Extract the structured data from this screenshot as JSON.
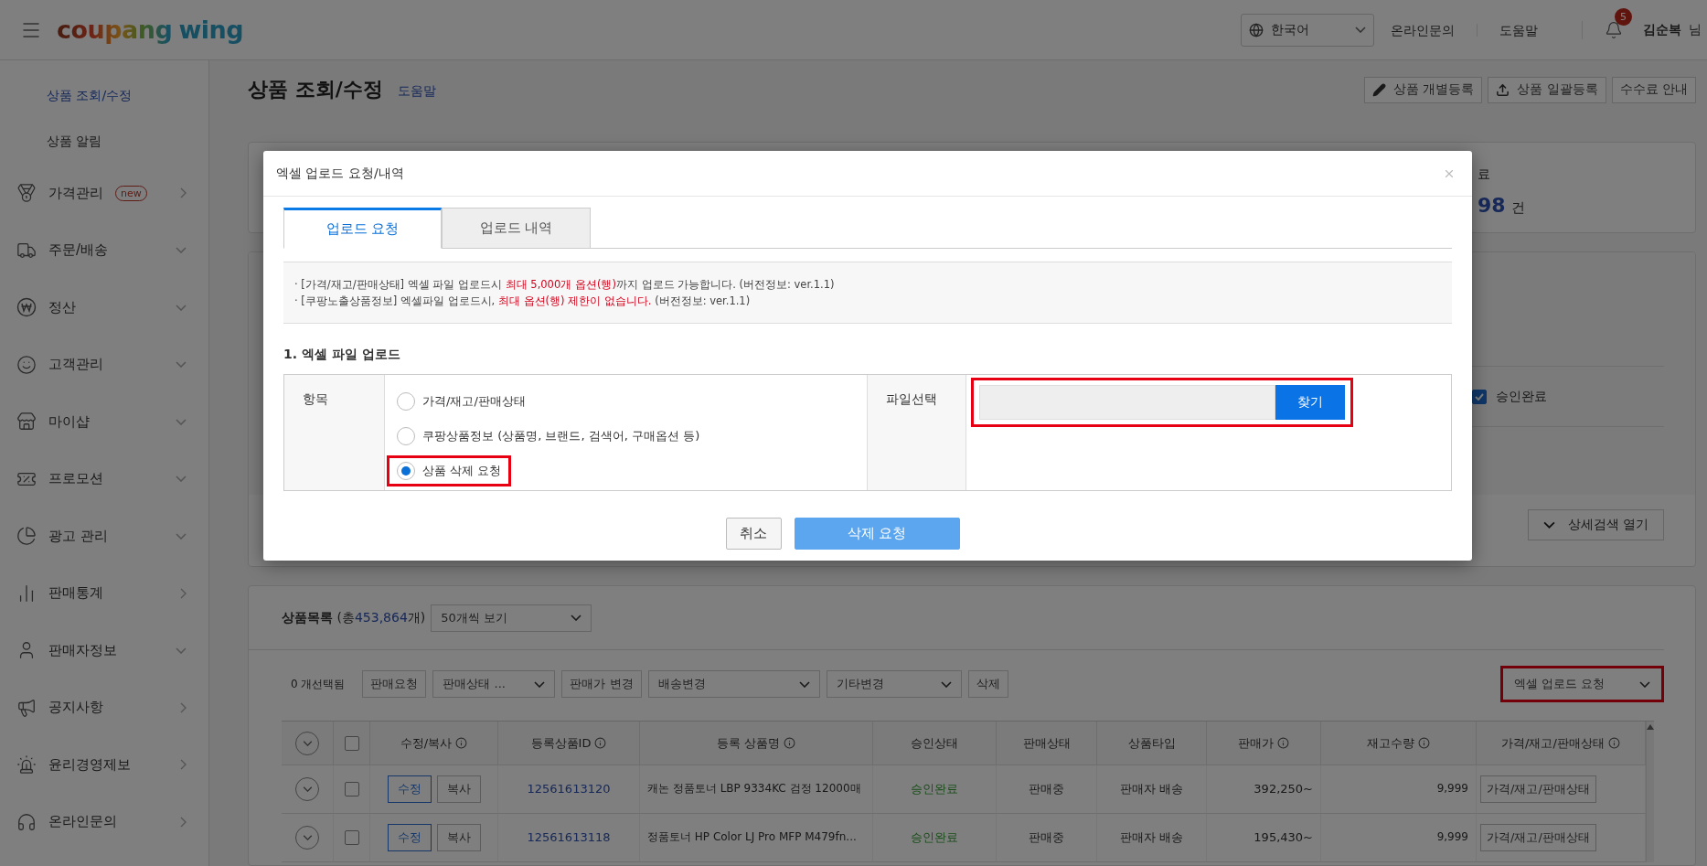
{
  "header": {
    "logo": {
      "brand": "coupang",
      "product": "wing"
    },
    "language": "한국어",
    "links": [
      "온라인문의",
      "도움말"
    ],
    "notifications": "5",
    "user": {
      "name": "김순복",
      "suffix": "님"
    }
  },
  "sidebar": {
    "subitems": [
      {
        "label": "상품 조회/수정",
        "selected": true
      },
      {
        "label": "상품 알림",
        "selected": false
      }
    ],
    "items": [
      {
        "kind": "medal",
        "label": "가격관리",
        "badge": "new",
        "expandable": false
      },
      {
        "kind": "truck",
        "label": "주문/배송",
        "expandable": true
      },
      {
        "kind": "won",
        "label": "정산",
        "expandable": true
      },
      {
        "kind": "smile",
        "label": "고객관리",
        "expandable": true
      },
      {
        "kind": "store",
        "label": "마이샵",
        "expandable": true
      },
      {
        "kind": "coupon",
        "label": "프로모션",
        "expandable": true
      },
      {
        "kind": "pie",
        "label": "광고 관리",
        "expandable": true
      },
      {
        "kind": "bars",
        "label": "판매통계",
        "expandable": false
      },
      {
        "kind": "person",
        "label": "판매자정보",
        "expandable": true
      },
      {
        "kind": "megaphone",
        "label": "공지사항",
        "expandable": false
      },
      {
        "kind": "siren",
        "label": "윤리경영제보",
        "expandable": false
      },
      {
        "kind": "headset",
        "label": "온라인문의",
        "expandable": false
      }
    ]
  },
  "page": {
    "title": "상품 조회/수정",
    "help_link": "도움말",
    "actions": [
      {
        "kind": "pencil",
        "label": "상품 개별등록"
      },
      {
        "kind": "upload",
        "label": "상품 일괄등록"
      },
      {
        "kind": "plain",
        "label": "수수료 안내"
      }
    ]
  },
  "summary": {
    "label": "료",
    "count": "98",
    "unit": "건"
  },
  "filters": {
    "approved": {
      "label": "승인완료",
      "checked": true
    },
    "detail_search": "상세검색 열기"
  },
  "product_list": {
    "title": "상품목록",
    "total_prefix": "(총",
    "total": "453,864",
    "total_suffix": "개)",
    "page_size": "50개씩 보기",
    "toolbar": [
      {
        "kind": "text",
        "label": "0 개선택됨"
      },
      {
        "kind": "button",
        "label": "판매요청"
      },
      {
        "kind": "select",
        "label": "판매상태 ..."
      },
      {
        "kind": "button",
        "label": "판매가 변경"
      },
      {
        "kind": "select",
        "label": "배송변경"
      },
      {
        "kind": "select",
        "label": "기타변경"
      },
      {
        "kind": "button",
        "label": "삭제"
      }
    ],
    "excel_upload": {
      "label": "엑셀 업로드 요청",
      "highlighted": true
    },
    "header_checked": false,
    "columns": [
      {
        "label": "수정/복사",
        "info": true
      },
      {
        "label": "등록상품ID",
        "info": true
      },
      {
        "label": "등록 상품명",
        "info": true
      },
      {
        "label": "승인상태",
        "info": false
      },
      {
        "label": "판매상태",
        "info": false
      },
      {
        "label": "상품타입",
        "info": false
      },
      {
        "label": "판매가",
        "info": true
      },
      {
        "label": "재고수량",
        "info": true
      },
      {
        "label": "가격/재고/판매상태",
        "info": true
      }
    ],
    "rows": [
      {
        "checked": false,
        "edit": "수정",
        "copy": "복사",
        "id": "12561613120",
        "name": "캐논 정품토너 LBP 9334KC 검정 12000매",
        "approval": "승인완료",
        "status": "판매중",
        "type": "판매자 배송",
        "price": "392,250~",
        "stock": "9,999",
        "action": "가격/재고/판매상태"
      },
      {
        "checked": false,
        "edit": "수정",
        "copy": "복사",
        "id": "12561613118",
        "name": "정품토너 HP Color LJ Pro MFP M479fn...",
        "approval": "승인완료",
        "status": "판매중",
        "type": "판매자 배송",
        "price": "195,430~",
        "stock": "9,999",
        "action": "가격/재고/판매상태"
      }
    ]
  },
  "modal": {
    "title": "엑셀 업로드 요청/내역",
    "tabs": [
      {
        "label": "업로드 요청",
        "selected": true
      },
      {
        "label": "업로드 내역",
        "selected": false
      }
    ],
    "notices": [
      [
        {
          "text": "· [가격/재고/판매상태] 엑셀 파일 업로드시 ",
          "emphasis": false
        },
        {
          "text": "최대 5,000개 옵션(행)",
          "emphasis": true
        },
        {
          "text": "까지 업로드 가능합니다. (버전정보: ver.1.1)",
          "emphasis": false
        }
      ],
      [
        {
          "text": "· [쿠팡노출상품정보] 엑셀파일 업로드시, ",
          "emphasis": false
        },
        {
          "text": "최대 옵션(행) 제한이 없습니다.",
          "emphasis": true
        },
        {
          "text": " (버전정보: ver.1.1)",
          "emphasis": false
        }
      ]
    ],
    "section_title": "1. 엑셀 파일 업로드",
    "upload": {
      "item_label": "항목",
      "options": [
        {
          "label": "가격/재고/판매상태",
          "selected": false,
          "highlighted": false
        },
        {
          "label": "쿠팡상품정보 (상품명, 브랜드, 검색어, 구매옵션 등)",
          "selected": false,
          "highlighted": false
        },
        {
          "label": "상품 삭제 요청",
          "selected": true,
          "highlighted": true
        }
      ],
      "file_label": "파일선택",
      "file": {
        "button": "찾기",
        "highlighted": true
      }
    },
    "buttons": [
      {
        "kind": "secondary",
        "label": "취소"
      },
      {
        "kind": "primary",
        "label": "삭제 요청"
      }
    ]
  }
}
